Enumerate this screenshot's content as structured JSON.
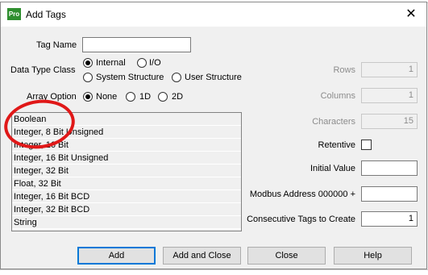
{
  "window": {
    "title": "Add Tags",
    "app_icon_text": "Pro"
  },
  "form": {
    "tag_name_label": "Tag Name",
    "tag_name_value": "",
    "data_type_class_label": "Data Type Class",
    "radio_internal": "Internal",
    "radio_io": "I/O",
    "radio_system_structure": "System Structure",
    "radio_user_structure": "User Structure",
    "array_option_label": "Array Option",
    "radio_none": "None",
    "radio_1d": "1D",
    "radio_2d": "2D"
  },
  "type_list": [
    "Boolean",
    "Integer, 8 Bit Unsigned",
    "Integer, 16 Bit",
    "Integer, 16 Bit Unsigned",
    "Integer, 32 Bit",
    "Float, 32 Bit",
    "Integer, 16 Bit BCD",
    "Integer, 32 Bit BCD",
    "String"
  ],
  "right": {
    "rows_label": "Rows",
    "rows_value": "1",
    "columns_label": "Columns",
    "columns_value": "1",
    "characters_label": "Characters",
    "characters_value": "15",
    "retentive_label": "Retentive",
    "initial_value_label": "Initial Value",
    "initial_value_value": "",
    "modbus_label": "Modbus Address 000000 +",
    "modbus_value": "",
    "consecutive_label": "Consecutive Tags to Create",
    "consecutive_value": "1"
  },
  "buttons": {
    "add": "Add",
    "add_close": "Add and Close",
    "close": "Close",
    "help": "Help"
  },
  "colors": {
    "annotation": "#e01818",
    "default_button_border": "#0078d7"
  }
}
